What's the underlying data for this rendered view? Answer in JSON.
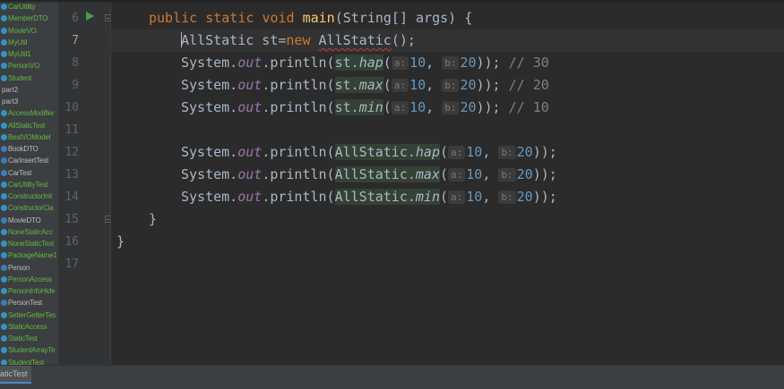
{
  "project": {
    "items": [
      {
        "label": "CarUtility",
        "kind": "test"
      },
      {
        "label": "MemberDTO",
        "kind": "test"
      },
      {
        "label": "MovieVO",
        "kind": "test"
      },
      {
        "label": "MyUtil",
        "kind": "test"
      },
      {
        "label": "MyUtil1",
        "kind": "test"
      },
      {
        "label": "PersonVO",
        "kind": "test"
      },
      {
        "label": "Student",
        "kind": "test"
      },
      {
        "label": "part2",
        "kind": "folder"
      },
      {
        "label": "part3",
        "kind": "folder"
      },
      {
        "label": "AccessModifier",
        "kind": "test"
      },
      {
        "label": "AllStaticTest",
        "kind": "test"
      },
      {
        "label": "BestVOModel",
        "kind": "test"
      },
      {
        "label": "BookDTO",
        "kind": "cls"
      },
      {
        "label": "CarInsertTest",
        "kind": "cls"
      },
      {
        "label": "CarTest",
        "kind": "cls"
      },
      {
        "label": "CarUtilityTest",
        "kind": "test"
      },
      {
        "label": "ConstructorInit",
        "kind": "test"
      },
      {
        "label": "ConstructorCla",
        "kind": "test"
      },
      {
        "label": "MovieDTO",
        "kind": "cls"
      },
      {
        "label": "NoneStaticAcc",
        "kind": "test"
      },
      {
        "label": "NoneStaticTest",
        "kind": "test"
      },
      {
        "label": "PackageName1",
        "kind": "test"
      },
      {
        "label": "Person",
        "kind": "cls"
      },
      {
        "label": "PersonAccess",
        "kind": "test"
      },
      {
        "label": "PersonInfoHide",
        "kind": "test"
      },
      {
        "label": "PersonTest",
        "kind": "cls"
      },
      {
        "label": "SetterGetterTes",
        "kind": "test"
      },
      {
        "label": "StaticAccess",
        "kind": "test"
      },
      {
        "label": "StaticTest",
        "kind": "test"
      },
      {
        "label": "StudentArrayTe",
        "kind": "test"
      },
      {
        "label": "StudentTest",
        "kind": "test"
      }
    ]
  },
  "editor": {
    "line_numbers": [
      "6",
      "7",
      "8",
      "9",
      "10",
      "11",
      "12",
      "13",
      "14",
      "15",
      "16",
      "17"
    ],
    "current_line": "7",
    "hints": {
      "a": "a:",
      "b": "b:"
    },
    "tokens": {
      "public": "public",
      "static": "static",
      "void": "void",
      "main": "main",
      "main_params": "(String[] args) {",
      "AllStatic": "AllStatic",
      "st_decl": " st=",
      "new": "new",
      "ctor_end": "();",
      "System": "System.",
      "out": "out",
      "println": ".println(",
      "st_dot": "st.",
      "AllStatic_dot": "AllStatic.",
      "hap": "hap",
      "max": "max",
      "min": "min",
      "open": "(",
      "n10": "10",
      "comma": ", ",
      "n20": "20",
      "close_cm": ")); ",
      "close_end": "));",
      "c30": "// 30",
      "c20": "// 20",
      "c10": "// 10",
      "brace": "}"
    }
  },
  "status": {
    "tab_label": "aticTest"
  },
  "colors": {
    "keyword": "#cc7832",
    "method": "#ffc66d",
    "number": "#6897bb",
    "comment": "#808080",
    "field": "#9876aa",
    "text": "#a9b7c6",
    "test_icon": "#3592c4",
    "run_icon": "#499c54"
  }
}
